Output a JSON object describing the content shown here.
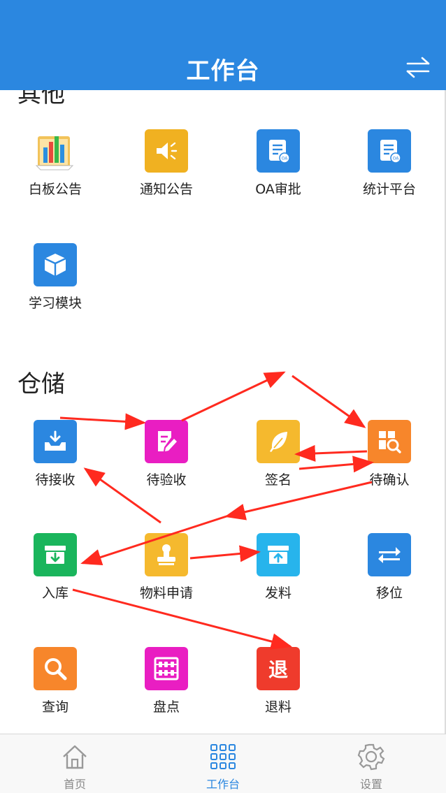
{
  "header": {
    "title": "工作台"
  },
  "sections": {
    "other_title": "其他",
    "storage_title": "仓储"
  },
  "other_items": [
    {
      "label": "白板公告",
      "icon": "whiteboard-icon"
    },
    {
      "label": "通知公告",
      "icon": "speaker-icon"
    },
    {
      "label": "OA审批",
      "icon": "oa-document-icon"
    },
    {
      "label": "统计平台",
      "icon": "oa-document-icon"
    },
    {
      "label": "学习模块",
      "icon": "cube-icon"
    }
  ],
  "storage_items": [
    {
      "label": "待接收",
      "icon": "inbox-download-icon",
      "color": "#2b87e0"
    },
    {
      "label": "待验收",
      "icon": "edit-doc-icon",
      "color": "#e91ec2"
    },
    {
      "label": "签名",
      "icon": "feather-icon",
      "color": "#f5b92e"
    },
    {
      "label": "待确认",
      "icon": "grid-search-icon",
      "color": "#f7862b"
    },
    {
      "label": "入库",
      "icon": "box-download-icon",
      "color": "#1ab55c"
    },
    {
      "label": "物料申请",
      "icon": "stamp-icon",
      "color": "#f5b92e"
    },
    {
      "label": "发料",
      "icon": "box-upload-icon",
      "color": "#27b4ec"
    },
    {
      "label": "移位",
      "icon": "swap-arrows-icon",
      "color": "#2b87e0"
    },
    {
      "label": "查询",
      "icon": "magnifier-icon",
      "color": "#f7862b"
    },
    {
      "label": "盘点",
      "icon": "abacus-icon",
      "color": "#e91ec2"
    },
    {
      "label": "退料",
      "icon": "return-glyph-icon",
      "color": "#ef3b2c",
      "glyph": "退"
    }
  ],
  "tabbar": {
    "home": "首页",
    "workbench": "工作台",
    "settings": "设置"
  },
  "colors": {
    "primary": "#2b87e0",
    "arrow": "#ff2a1f"
  }
}
